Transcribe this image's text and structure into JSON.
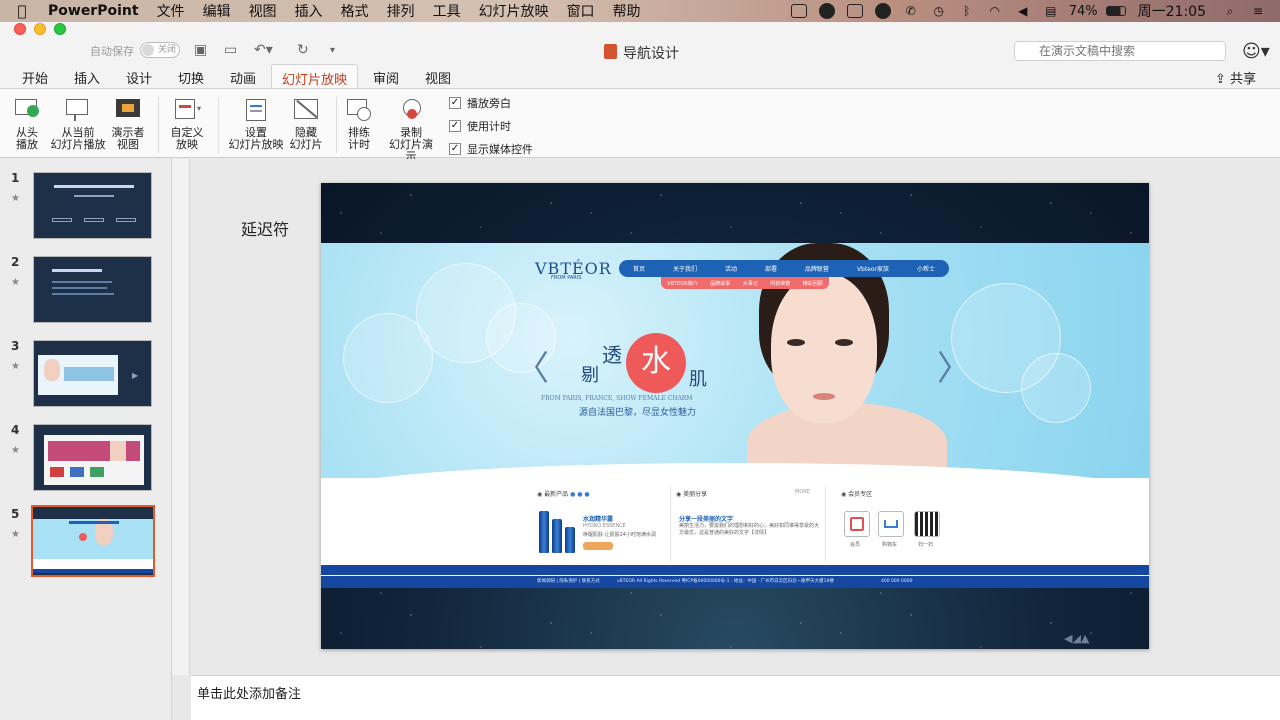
{
  "menubar": {
    "app_name": "PowerPoint",
    "items": [
      "文件",
      "编辑",
      "视图",
      "插入",
      "格式",
      "排列",
      "工具",
      "幻灯片放映",
      "窗口",
      "帮助"
    ],
    "battery": "74%",
    "clock": "周一21:05"
  },
  "titlebar": {
    "autosave_label": "自动保存",
    "autosave_state": "关闭",
    "doc_title": "导航设计",
    "search_placeholder": "在演示文稿中搜索"
  },
  "tabs": [
    {
      "label": "开始"
    },
    {
      "label": "插入"
    },
    {
      "label": "设计"
    },
    {
      "label": "切换"
    },
    {
      "label": "动画"
    },
    {
      "label": "幻灯片放映",
      "active": true
    },
    {
      "label": "审阅"
    },
    {
      "label": "视图"
    }
  ],
  "share_label": "共享",
  "ribbon": {
    "from_start": [
      "从头",
      "播放"
    ],
    "from_current": [
      "从当前",
      "幻灯片播放"
    ],
    "presenter": [
      "演示者",
      "视图"
    ],
    "custom": [
      "自定义",
      "放映"
    ],
    "setup": [
      "设置",
      "幻灯片放映"
    ],
    "hide": [
      "隐藏",
      "幻灯片"
    ],
    "rehearse": [
      "排练",
      "计时"
    ],
    "record": [
      "录制",
      "幻灯片演示"
    ],
    "checks": [
      {
        "label": "播放旁白",
        "checked": true
      },
      {
        "label": "使用计时",
        "checked": true
      },
      {
        "label": "显示媒体控件",
        "checked": true
      }
    ]
  },
  "thumbnails": [
    {
      "num": "1"
    },
    {
      "num": "2"
    },
    {
      "num": "3"
    },
    {
      "num": "4"
    },
    {
      "num": "5",
      "selected": true
    }
  ],
  "slide": {
    "delay_label": "延迟符",
    "web": {
      "logo": "VBTÉOR",
      "logo_sub": "FROM PARIS",
      "nav": [
        "首页",
        "关于我们",
        "活动",
        "部署",
        "品牌联营",
        "Vbteor家族",
        "小帮士"
      ],
      "subnav": [
        "VBTEOR简介",
        "品牌故事",
        "大事记",
        "所获荣誉",
        "精彩回顾"
      ],
      "hero_c1": "剔",
      "hero_c2": "透",
      "hero_water": "水",
      "hero_c3": "肌",
      "hero_en": "FROM PARIS, FRANCE, SHOW FEMALE CHARM",
      "hero_cn": "源自法国巴黎，尽显女性魅力",
      "col1": "最新产品",
      "col2": "美丽分享",
      "col3": "会员专区",
      "more": "MORE",
      "prod_title": "水润精华露",
      "prod_sub": "HYDRO ESSENCE",
      "prod_desc": "唤醒肌肤·让肌肤24小时饱满水润",
      "share_title": "分享一段美丽的文字",
      "share_text": "美丽生活力，要需我们的理想和好的心，美好如同谁得享受的大方最优，这是普通的美好的文字【详情】",
      "members": [
        "会员",
        "购物车",
        "扫一扫"
      ],
      "footer_links": "新闻调研 | 隐私保护 | 联系方式",
      "footer_copy": "vBTEOR All Rights Reserved 粤ICP备00000000号-1 · 地址：中国 · 广州市白云区白云一路甲天大厦19楼",
      "footer_tel": "400 000 0000"
    }
  },
  "notes_placeholder": "单击此处添加备注",
  "colors": {
    "accent": "#c43e1c",
    "selection": "#e05a2b"
  }
}
